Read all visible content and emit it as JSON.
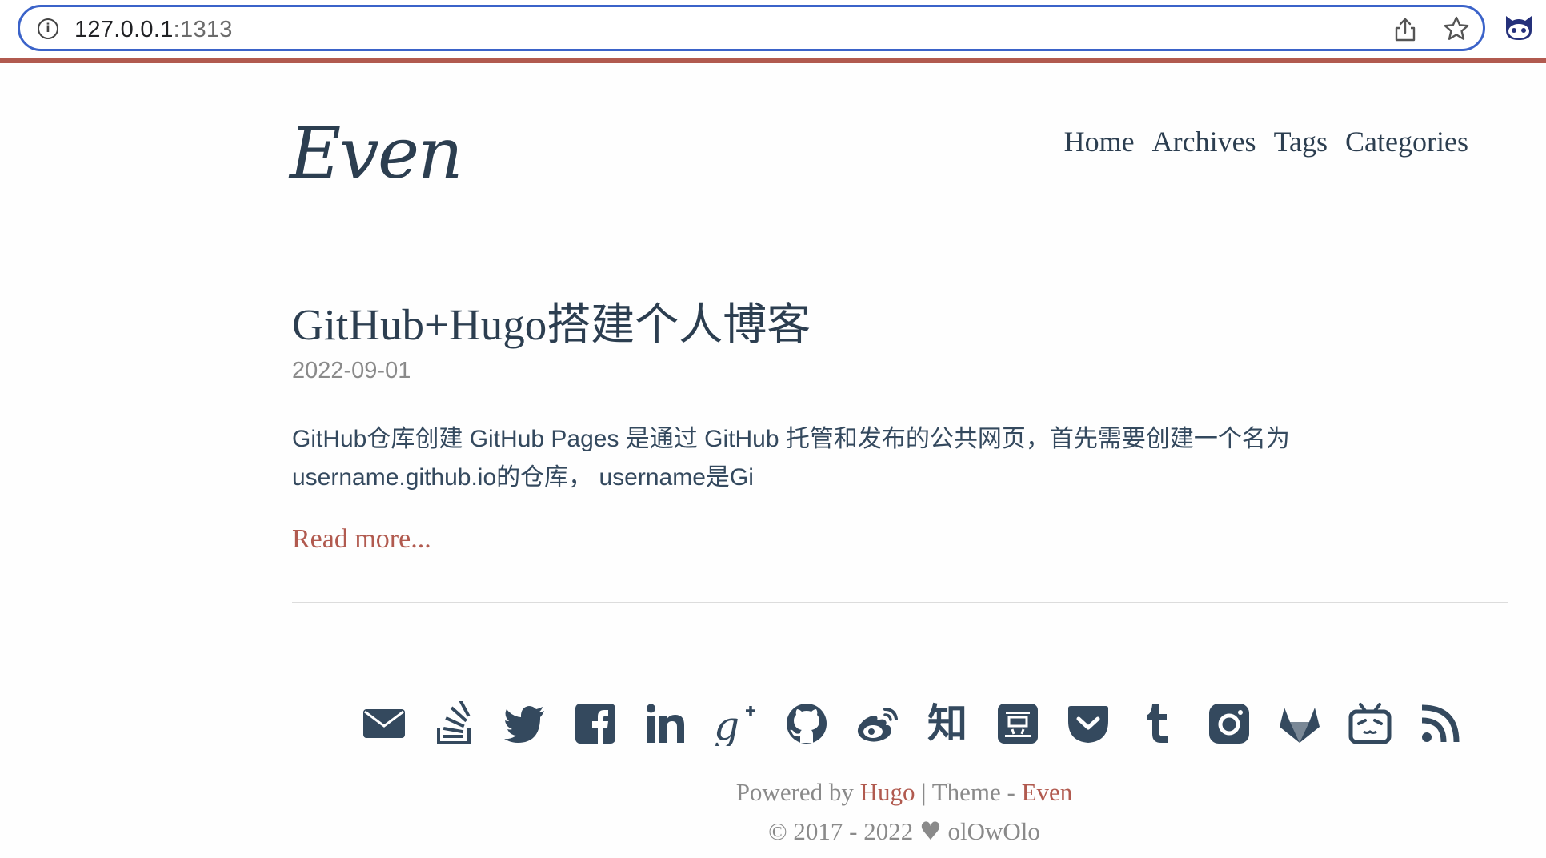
{
  "browser": {
    "url_host": "127.0.0.1",
    "url_port": ":1313"
  },
  "site": {
    "logo": "Even",
    "nav": [
      "Home",
      "Archives",
      "Tags",
      "Categories"
    ]
  },
  "post": {
    "title": "GitHub+Hugo搭建个人博客",
    "date": "2022-09-01",
    "summary": "GitHub仓库创建 GitHub Pages 是通过 GitHub 托管和发布的公共网页，首先需要创建一个名为username.github.io的仓库， username是Gi",
    "read_more": "Read more..."
  },
  "social_icons": [
    "email-icon",
    "stack-overflow-icon",
    "twitter-icon",
    "facebook-icon",
    "linkedin-icon",
    "google-plus-icon",
    "github-icon",
    "weibo-icon",
    "zhihu-icon",
    "douban-icon",
    "pocket-icon",
    "tumblr-icon",
    "instagram-icon",
    "gitlab-icon",
    "bilibili-icon",
    "rss-icon"
  ],
  "zhihu_glyph": "知",
  "footer": {
    "powered_prefix": "Powered by",
    "hugo": "Hugo",
    "theme_sep": "| Theme -",
    "even": "Even",
    "years": "© 2017 - 2022",
    "author": "olOwOlo"
  },
  "colors": {
    "accent": "#b15a4f",
    "text": "#34495e",
    "muted": "#8a8a8a",
    "url_border": "#3b63c9"
  }
}
